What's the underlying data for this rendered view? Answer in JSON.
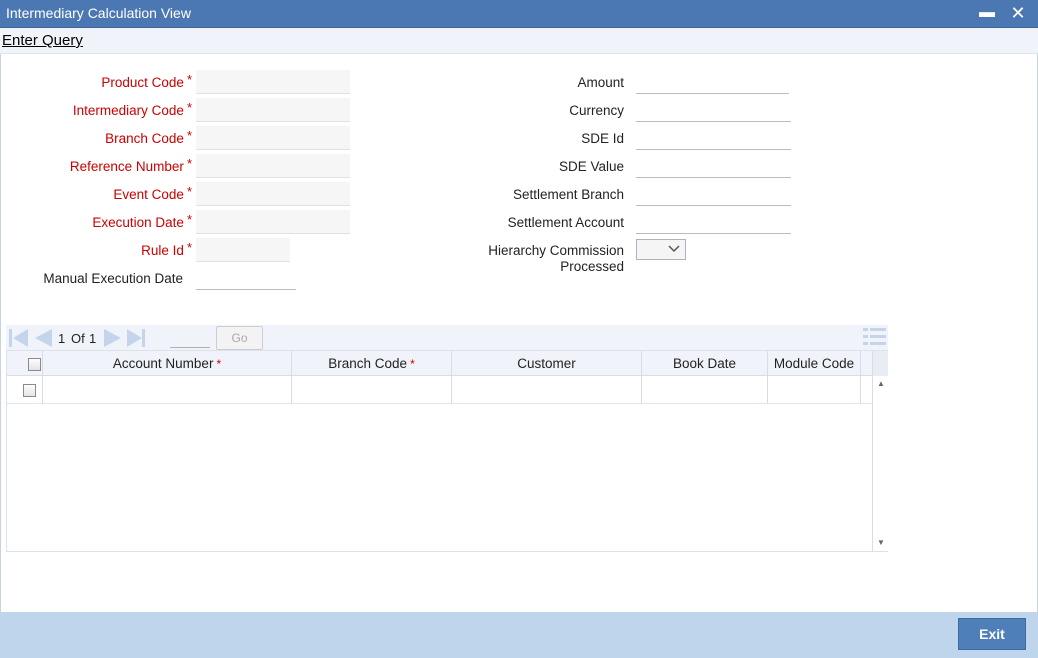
{
  "window": {
    "title": "Intermediary Calculation View",
    "minimize_label": "▬",
    "close_label": "✕"
  },
  "query": {
    "enter_query_label": "Enter Query"
  },
  "left_fields": [
    {
      "label": "Product Code",
      "required": "*"
    },
    {
      "label": "Intermediary Code",
      "required": "*"
    },
    {
      "label": "Branch Code",
      "required": "*"
    },
    {
      "label": "Reference Number",
      "required": "*"
    },
    {
      "label": "Event Code",
      "required": "*"
    },
    {
      "label": "Execution Date",
      "required": "*"
    },
    {
      "label": "Rule Id",
      "required": "*"
    },
    {
      "label": "Manual Execution Date",
      "required": ""
    }
  ],
  "right_fields": [
    {
      "label": "Amount"
    },
    {
      "label": "Currency"
    },
    {
      "label": "SDE Id"
    },
    {
      "label": "SDE Value"
    },
    {
      "label": "Settlement Branch"
    },
    {
      "label": "Settlement Account"
    },
    {
      "label": "Hierarchy Commission Processed",
      "selected": ""
    }
  ],
  "pager": {
    "current": "1",
    "of_label": "Of",
    "total": "1",
    "go_label": "Go"
  },
  "grid": {
    "columns": [
      {
        "label": "Account Number",
        "required": "*"
      },
      {
        "label": "Branch Code",
        "required": "*"
      },
      {
        "label": "Customer",
        "required": ""
      },
      {
        "label": "Book Date",
        "required": ""
      },
      {
        "label": "Module Code",
        "required": ""
      }
    ],
    "rows": [
      {
        "account_number": "",
        "branch_code": "",
        "customer": "",
        "book_date": "",
        "module_code": ""
      }
    ]
  },
  "footer": {
    "exit_label": "Exit"
  },
  "colors": {
    "titlebar": "#4b78b2",
    "required": "#cc0000",
    "footer": "#bfd5ec",
    "exit_button": "#4f7fb8"
  }
}
